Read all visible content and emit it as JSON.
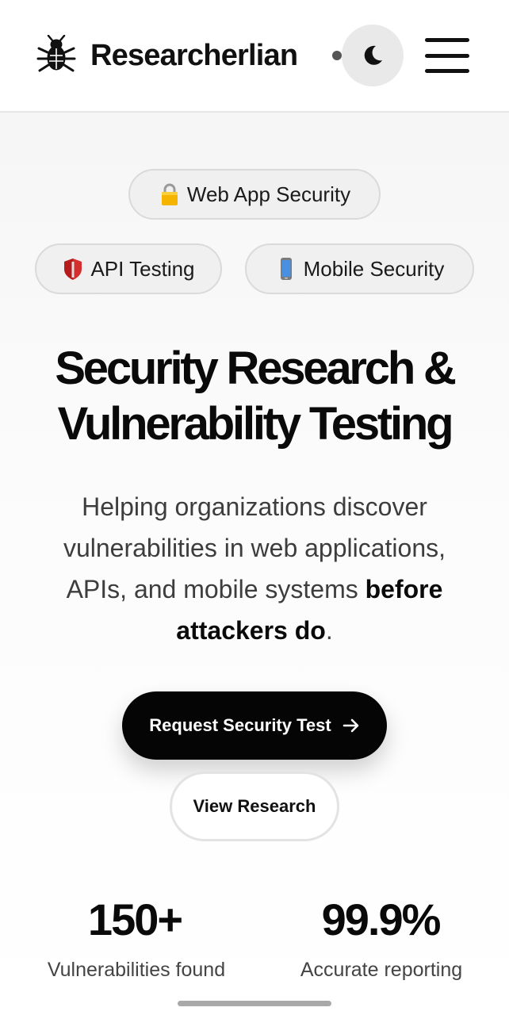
{
  "header": {
    "brand_name": "Researcherlian",
    "brand_icon": "bug-icon",
    "theme_toggle_icon": "moon-icon",
    "menu_icon": "hamburger-menu-icon"
  },
  "chips": [
    {
      "label": "Web App Security",
      "icon": "lock-icon"
    },
    {
      "label": "API Testing",
      "icon": "shield-icon"
    },
    {
      "label": "Mobile Security",
      "icon": "mobile-phone-icon"
    }
  ],
  "hero": {
    "title_line1": "Security Research &",
    "title_line2": "Vulnerability Testing",
    "description": "Helping organizations discover vulnerabilities in web applications, APIs, and mobile systems",
    "description_bold": "before attackers do",
    "description_end": "."
  },
  "buttons": {
    "primary_label": "Request Security Test",
    "primary_icon": "arrow-right-icon",
    "secondary_label": "View Research"
  },
  "stats": [
    {
      "value": "150+",
      "label": "Vulnerabilities found"
    },
    {
      "value": "99.9%",
      "label": "Accurate reporting"
    }
  ],
  "colors": {
    "primary_button": "#050505",
    "chip_background": "#f0f0f0",
    "lock_icon": "#f5b400",
    "shield_icon": "#d32f2f",
    "phone_icon": "#4a90e2"
  }
}
